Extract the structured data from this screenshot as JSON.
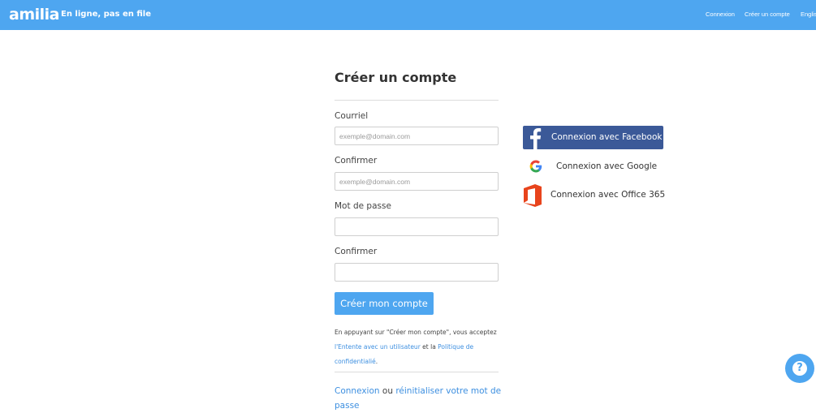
{
  "header": {
    "logo": "amilia",
    "tagline": "En ligne, pas en file",
    "nav": {
      "login": "Connexion",
      "create_account": "Créer un compte",
      "language": "English"
    }
  },
  "form": {
    "title": "Créer un compte",
    "email_label": "Courriel",
    "email_placeholder": "exemple@domain.com",
    "email_confirm_label": "Confirmer",
    "email_confirm_placeholder": "exemple@domain.com",
    "password_label": "Mot de passe",
    "password_confirm_label": "Confirmer",
    "submit_label": "Créer mon compte",
    "terms": {
      "prefix": "En appuyant sur \"Créer mon compte\", vous acceptez ",
      "user_agreement_link": "l'Entente avec un utilisateur",
      "middle": " et la ",
      "privacy_link": "Politique de confidentialié",
      "suffix": "."
    },
    "bottom": {
      "login_link": "Connexion",
      "middle": " ou ",
      "reset_link": "réinitialiser votre mot de passe"
    }
  },
  "social": {
    "facebook_label": "Connexion avec Facebook",
    "google_label": "Connexion avec Google",
    "office_label": "Connexion avec Office 365"
  },
  "help": {
    "icon_text": "?"
  },
  "colors": {
    "brand": "#4ea6f0",
    "facebook": "#3b5998",
    "link": "#3d8fe0",
    "office": "#e8441c"
  }
}
